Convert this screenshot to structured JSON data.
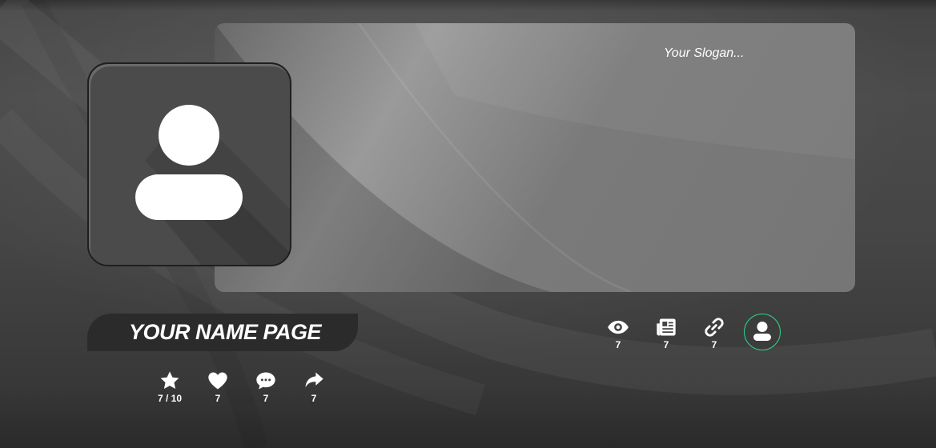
{
  "page": {
    "name_title": "YOUR NAME PAGE",
    "slogan": "Your Slogan..."
  },
  "stats_left": {
    "rating": "7 / 10",
    "likes": "7",
    "comments": "7",
    "shares": "7"
  },
  "stats_right": {
    "views": "7",
    "posts": "7",
    "links": "7"
  },
  "colors": {
    "accent_ring": "#2bd38a",
    "name_tab": "#2b2b2b"
  },
  "icons": [
    "star-icon",
    "heart-icon",
    "comment-icon",
    "share-icon",
    "eye-icon",
    "newspaper-icon",
    "link-icon",
    "user-icon"
  ]
}
